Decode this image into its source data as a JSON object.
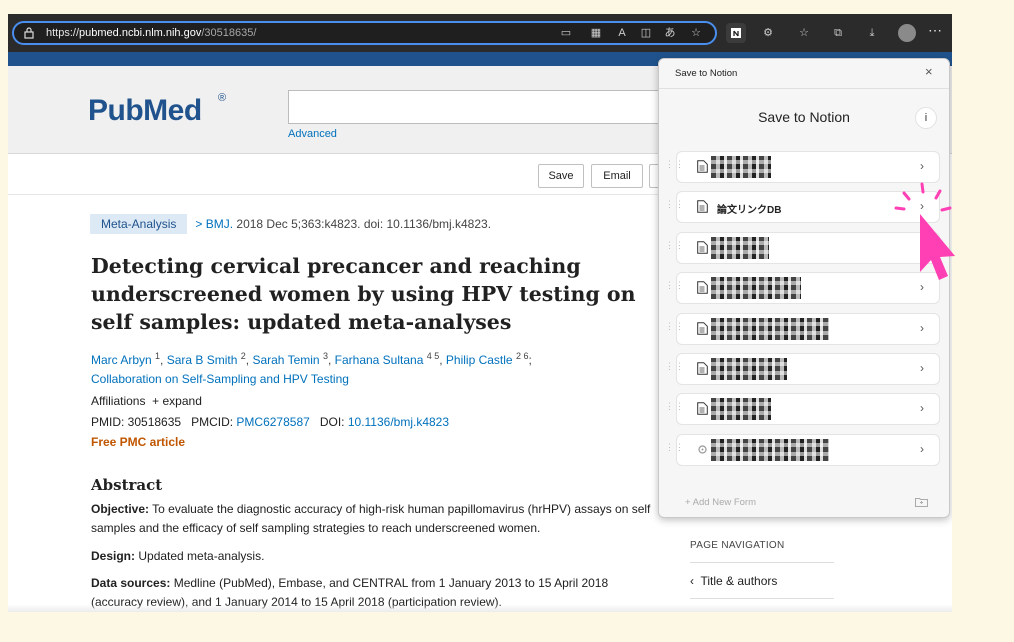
{
  "browser": {
    "url_scheme": "https://",
    "url_host": "pubmed.ncbi.nlm.nih.gov",
    "url_path": "/30518635/",
    "icons": [
      "lock-icon",
      "reader-icon",
      "apps-icon",
      "read-aloud-icon",
      "immersive-icon",
      "translate-icon",
      "favorite-add-icon",
      "notion-extension-icon",
      "extension-icon",
      "favorites-icon",
      "collections-icon",
      "downloads-icon",
      "profile-icon",
      "more-icon"
    ]
  },
  "header": {
    "logo_text": "PubMed",
    "logo_reg": "®",
    "advanced_link": "Advanced"
  },
  "actions": {
    "save": "Save",
    "email": "Email"
  },
  "article": {
    "badge": "Meta-Analysis",
    "cite_arrow": ">",
    "journal": "BMJ.",
    "citation": " 2018 Dec 5;363:k4823. doi: 10.1136/bmj.k4823.",
    "title": "Detecting cervical precancer and reaching underscreened women by using HPV testing on self samples: updated meta-analyses",
    "authors": [
      {
        "name": "Marc Arbyn",
        "sup": "1"
      },
      {
        "name": "Sara B Smith",
        "sup": "2"
      },
      {
        "name": "Sarah Temin",
        "sup": "3"
      },
      {
        "name": "Farhana Sultana",
        "sup": "4 5"
      },
      {
        "name": "Philip Castle",
        "sup": "2 6"
      }
    ],
    "collab": "Collaboration on Self-Sampling and HPV Testing",
    "affiliations_label": "Affiliations",
    "expand": "+ expand",
    "pmid_label": "PMID: ",
    "pmid": "30518635",
    "pmcid_label": "PMCID: ",
    "pmcid": "PMC6278587",
    "doi_label": "DOI: ",
    "doi": "10.1136/bmj.k4823",
    "free_pmc": "Free PMC article"
  },
  "abstract": {
    "heading": "Abstract",
    "objective_label": "Objective:",
    "objective": " To evaluate the diagnostic accuracy of high-risk human papillomavirus (hrHPV) assays on self samples and the efficacy of self sampling strategies to reach underscreened women.",
    "design_label": "Design:",
    "design": " Updated meta-analysis.",
    "sources_label": "Data sources:",
    "sources": " Medline (PubMed), Embase, and CENTRAL from 1 January 2013 to 15 April 2018 (accuracy review), and 1 January 2014 to 15 April 2018 (participation review)."
  },
  "page_nav": {
    "title": "PAGE NAVIGATION",
    "item": "Title & authors"
  },
  "notion_popup": {
    "bar_title": "Save to Notion",
    "heading": "Save to Notion",
    "info": "i",
    "close": "×",
    "forms": [
      {
        "label": "",
        "redacted": true,
        "icon": "page-icon"
      },
      {
        "label": "論文リンクDB",
        "redacted": false,
        "icon": "page-icon"
      },
      {
        "label": "",
        "redacted": true,
        "icon": "page-icon"
      },
      {
        "label": "",
        "redacted": true,
        "icon": "page-icon"
      },
      {
        "label": "",
        "redacted": true,
        "icon": "page-icon"
      },
      {
        "label": "",
        "redacted": true,
        "icon": "page-icon"
      },
      {
        "label": "",
        "redacted": true,
        "icon": "page-icon"
      },
      {
        "label": "",
        "redacted": true,
        "icon": "gear-icon"
      }
    ],
    "add_new_form": "+ Add New Form",
    "accent_color": "#ff3fb4"
  }
}
